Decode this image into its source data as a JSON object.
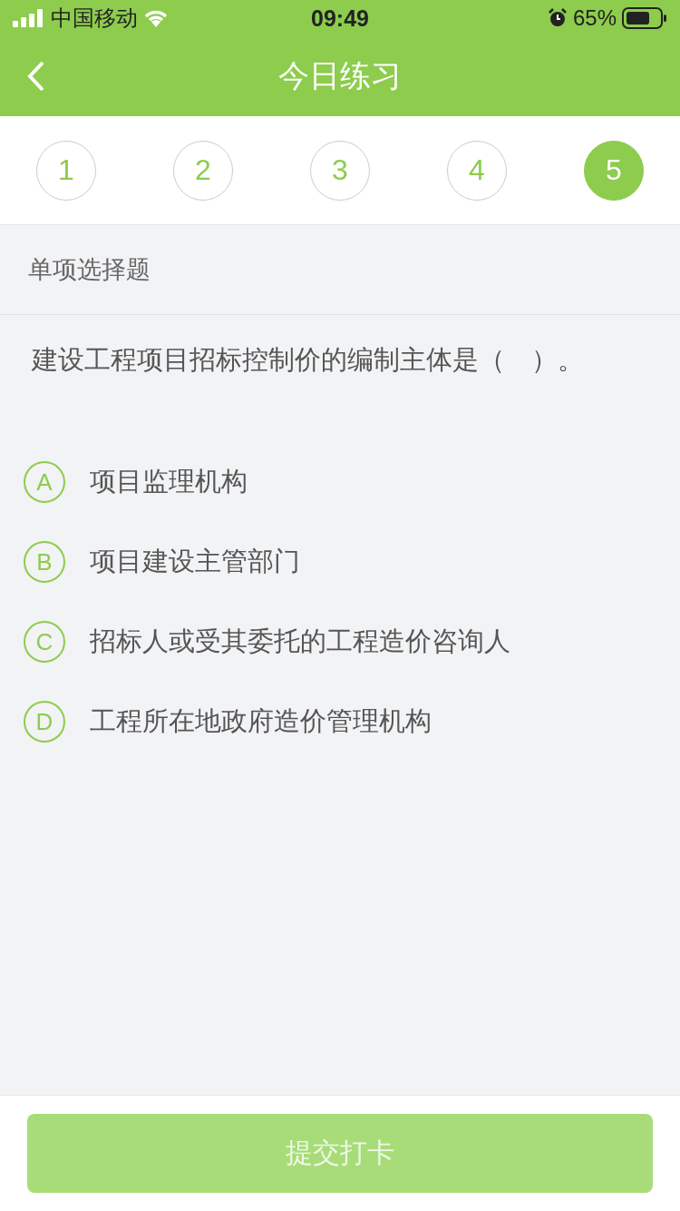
{
  "status_bar": {
    "carrier": "中国移动",
    "time": "09:49",
    "battery": "65%"
  },
  "header": {
    "title": "今日练习"
  },
  "question_tabs": [
    {
      "label": "1",
      "selected": false
    },
    {
      "label": "2",
      "selected": false
    },
    {
      "label": "3",
      "selected": false
    },
    {
      "label": "4",
      "selected": false
    },
    {
      "label": "5",
      "selected": true
    }
  ],
  "section": {
    "title": "单项选择题"
  },
  "question": {
    "text": "建设工程项目招标控制价的编制主体是（　）。"
  },
  "options": [
    {
      "letter": "A",
      "text": "项目监理机构",
      "selected": false
    },
    {
      "letter": "B",
      "text": "项目建设主管部门",
      "selected": false
    },
    {
      "letter": "C",
      "text": "招标人或受其委托的工程造价咨询人",
      "selected": false
    },
    {
      "letter": "D",
      "text": "工程所在地政府造价管理机构",
      "selected": false
    }
  ],
  "submit_button": {
    "label": "提交打卡",
    "disabled": true
  }
}
